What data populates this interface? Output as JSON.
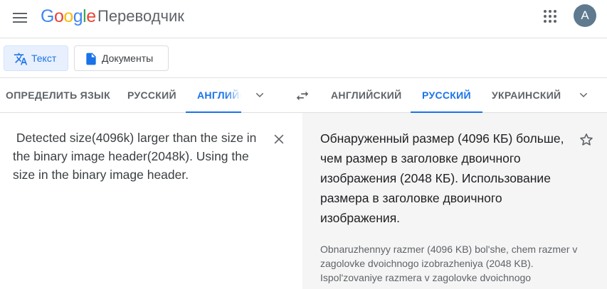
{
  "header": {
    "logo_letters": [
      "G",
      "o",
      "o",
      "g",
      "l",
      "e"
    ],
    "product_name": "Переводчик",
    "avatar_letter": "A",
    "icons": {
      "menu": "hamburger-menu-icon",
      "apps": "apps-grid-icon"
    }
  },
  "modes": {
    "text_label": "Текст",
    "documents_label": "Документы",
    "icons": {
      "text": "translate-icon",
      "documents": "document-icon"
    }
  },
  "source_langs": {
    "detect": "ОПРЕДЕЛИТЬ ЯЗЫК",
    "russian": "РУССКИЙ",
    "english_truncated": "АНГЛИЙСКИЙ"
  },
  "target_langs": {
    "english": "АНГЛИЙСКИЙ",
    "russian": "РУССКИЙ",
    "ukrainian": "УКРАИНСКИЙ"
  },
  "source": {
    "text": " Detected size(4096k) larger than the size in the binary image header(2048k). Using the size in the binary image header."
  },
  "target": {
    "text": "Обнаруженный размер (4096 КБ) больше, чем размер в заголовке двоичного изображения (2048 КБ). Использование размера в заголовке двоичного изображения.",
    "transliteration": "Obnaruzhennyy razmer (4096 KB) bol'she, chem razmer v zagolovke dvoichnogo izobrazheniya (2048 KB). Ispol'zovaniye razmera v zagolovke dvoichnogo"
  },
  "colors": {
    "accent": "#1a73e8",
    "active_bg": "#e8f0fe",
    "target_panel_bg": "#f5f5f5",
    "avatar_bg": "#5f7a8f"
  }
}
